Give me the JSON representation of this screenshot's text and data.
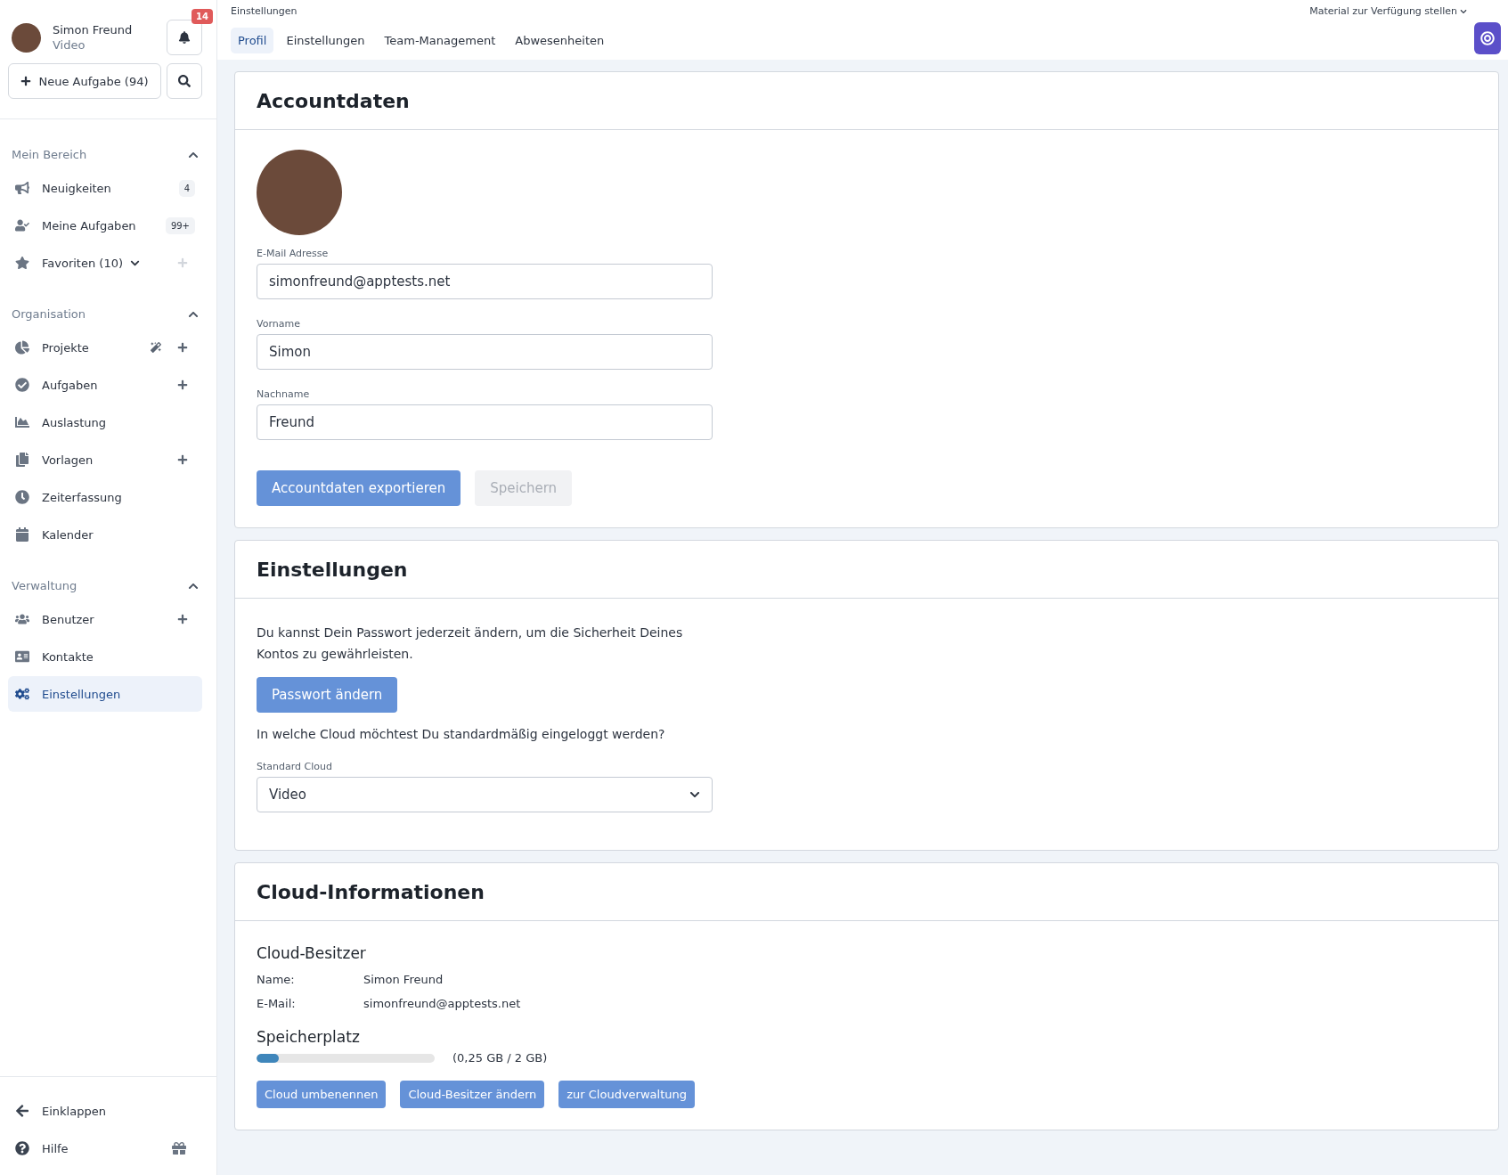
{
  "user": {
    "name": "Simon Freund",
    "cloud": "Video",
    "notifications": "14"
  },
  "new_task_button": "Neue Aufgabe (94)",
  "sidebar_sections": [
    {
      "title": "Mein Bereich",
      "expanded": true,
      "items": [
        {
          "label": "Neuigkeiten",
          "badge": "4",
          "selected": false
        },
        {
          "label": "Meine Aufgaben",
          "badge": "99+",
          "selected": false
        },
        {
          "label": "Favoriten (10)",
          "expanded": false,
          "actions": [
            {
              "kind": "plus",
              "disabled": true
            }
          ],
          "selected": false
        }
      ]
    },
    {
      "title": "Organisation",
      "expanded": true,
      "items": [
        {
          "label": "Projekte",
          "actions": [
            {
              "kind": "wand",
              "disabled": false
            },
            {
              "kind": "plus",
              "disabled": false
            }
          ],
          "selected": false
        },
        {
          "label": "Aufgaben",
          "actions": [
            {
              "kind": "plus",
              "disabled": false
            }
          ],
          "selected": false
        },
        {
          "label": "Auslastung",
          "selected": false
        },
        {
          "label": "Vorlagen",
          "actions": [
            {
              "kind": "plus",
              "disabled": false
            }
          ],
          "selected": false
        },
        {
          "label": "Zeiterfassung",
          "selected": false
        },
        {
          "label": "Kalender",
          "selected": false
        }
      ]
    },
    {
      "title": "Verwaltung",
      "expanded": true,
      "items": [
        {
          "label": "Benutzer",
          "actions": [
            {
              "kind": "plus",
              "disabled": false
            }
          ],
          "selected": false
        },
        {
          "label": "Kontakte",
          "selected": false
        },
        {
          "label": "Einstellungen",
          "selected": true
        }
      ]
    }
  ],
  "sidebar_footer": [
    {
      "label": "Einklappen"
    },
    {
      "label": "Hilfe"
    }
  ],
  "breadcrumb": "Einstellungen",
  "material_menu": "Material zur Verfügung stellen",
  "tabs": [
    {
      "label": "Profil",
      "selected": true
    },
    {
      "label": "Einstellungen",
      "selected": false
    },
    {
      "label": "Team-Management",
      "selected": false
    },
    {
      "label": "Abwesenheiten",
      "selected": false
    }
  ],
  "account": {
    "title": "Accountdaten",
    "fields": [
      {
        "label": "E-Mail Adresse",
        "value": "simonfreund@apptests.net"
      },
      {
        "label": "Vorname",
        "value": "Simon"
      },
      {
        "label": "Nachname",
        "value": "Freund"
      }
    ],
    "buttons": [
      {
        "label": "Accountdaten exportieren",
        "disabled": false
      },
      {
        "label": "Speichern",
        "disabled": true
      }
    ]
  },
  "settings": {
    "title": "Einstellungen",
    "password_text": "Du kannst Dein Passwort jederzeit ändern, um die Sicherheit Deines Kontos zu gewährleisten.",
    "password_button": "Passwort ändern",
    "cloud_question": "In welche Cloud möchtest Du standardmäßig eingeloggt werden?",
    "cloud_select": {
      "label": "Standard Cloud",
      "value": "Video"
    }
  },
  "cloud_info": {
    "title": "Cloud-Informationen",
    "owner_title": "Cloud-Besitzer",
    "owner_rows": [
      {
        "label": "Name:",
        "value": "Simon Freund"
      },
      {
        "label": "E-Mail:",
        "value": "simonfreund@apptests.net"
      }
    ],
    "storage_title": "Speicherplatz",
    "storage": {
      "level": 0.125,
      "reading": "(0,25 GB / 2 GB)"
    },
    "buttons": [
      "Cloud umbenennen",
      "Cloud-Besitzer ändern",
      "zur Cloudverwaltung"
    ]
  }
}
